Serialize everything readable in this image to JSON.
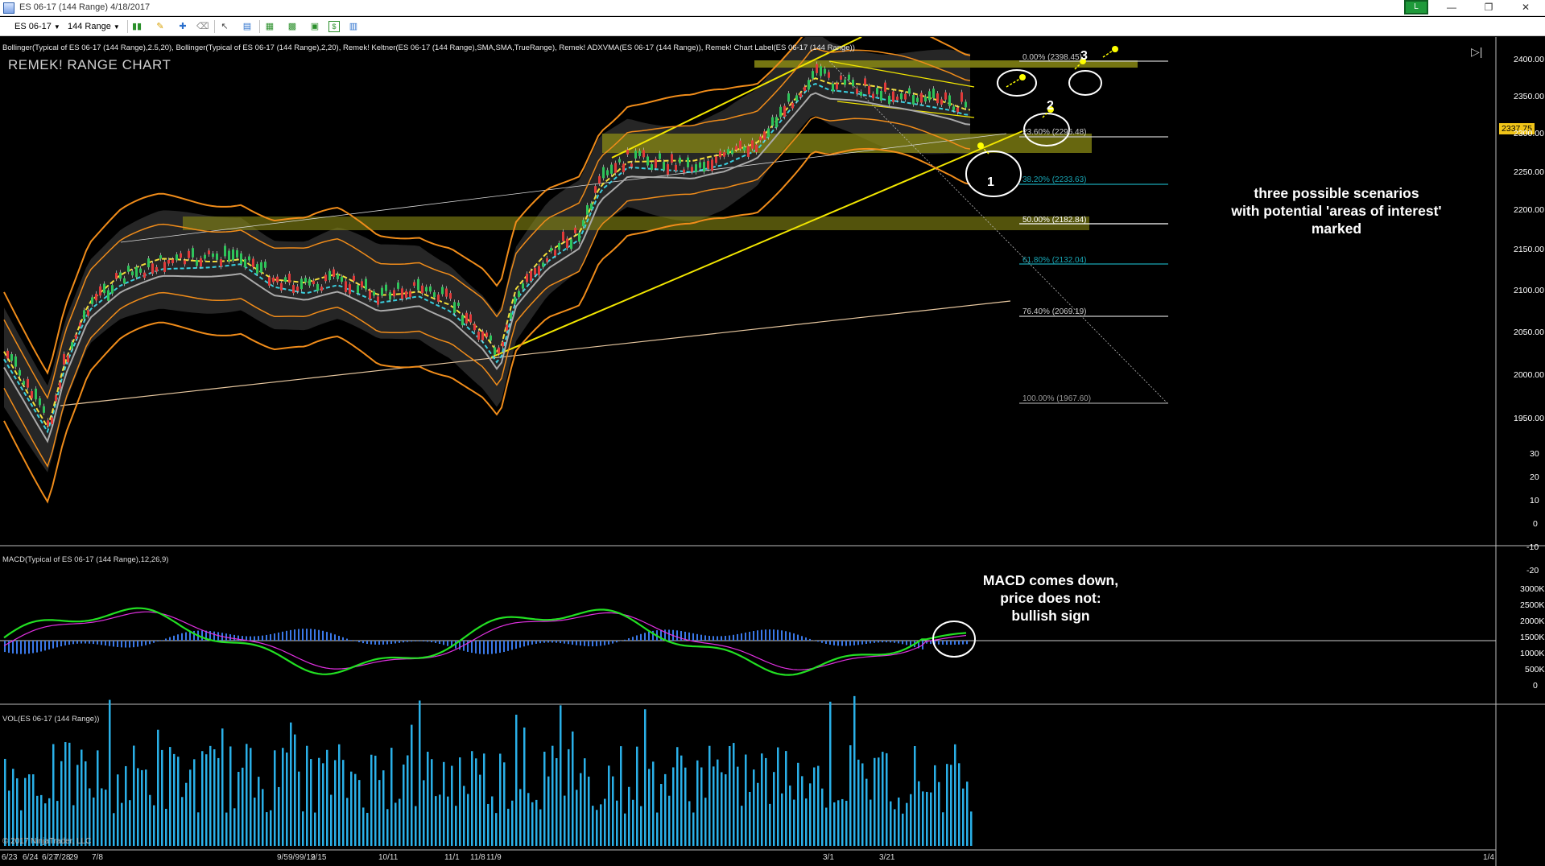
{
  "window": {
    "title": "ES 06-17 (144 Range)  4/18/2017",
    "connection": "L",
    "minimize": "—",
    "restore": "❐",
    "close": "✕"
  },
  "toolbar": {
    "instrument": "ES 06-17",
    "interval": "144 Range",
    "icons": [
      "bar-style-icon",
      "drawing-pencil-icon",
      "crosshair-icon",
      "eraser-icon",
      "pointer-icon",
      "data-box-icon",
      "indicators-icon",
      "strategies-icon",
      "properties-icon",
      "price-marker-icon"
    ]
  },
  "chart": {
    "indicator_description": "Bollinger(Typical of ES 06-17 (144 Range),2.5,20), Bollinger(Typical of ES 06-17 (144 Range),2,20), Remek! Keltner(ES 06-17 (144 Range),SMA,SMA,TrueRange), Remek! ADXVMA(ES 06-17 (144 Range)), Remek! Chart Label(ES 06-17 (144 Range))",
    "label": "REMEK! RANGE CHART",
    "macd_label": "MACD(Typical of ES 06-17 (144 Range),12,26,9)",
    "volume_label": "VOL(ES 06-17 (144 Range))",
    "copyright": "© 2017 NinjaTrader, LLC",
    "last_price": "2337.75",
    "price_ticks": [
      "2400.00",
      "2350.00",
      "2300.00",
      "2250.00",
      "2200.00",
      "2150.00",
      "2100.00",
      "2050.00",
      "2000.00",
      "1950.00"
    ],
    "macd_ticks": [
      "30",
      "20",
      "10",
      "0",
      "-10",
      "-20"
    ],
    "volume_ticks": [
      "3000K",
      "2500K",
      "2000K",
      "1500K",
      "1000K",
      "500K",
      "0"
    ],
    "date_ticks": [
      "6/23",
      "6/24",
      "6/27",
      "7/28",
      "29",
      "7/8",
      "9/5",
      "9/9",
      "9/12",
      "9/15",
      "10/11",
      "11/1",
      "11/8",
      "11/9",
      "3/1",
      "3/21",
      "1/4"
    ],
    "fib_levels": [
      {
        "label": "0.00% (2398.45)",
        "color": "#cccccc"
      },
      {
        "label": "23.60% (2296.48)",
        "color": "#cccccc"
      },
      {
        "label": "38.20% (2233.63)",
        "color": "#19a6b5"
      },
      {
        "label": "50.00% (2182.84)",
        "color": "#ffffff"
      },
      {
        "label": "61.80% (2132.04)",
        "color": "#19a6b5"
      },
      {
        "label": "76.40% (2069.19)",
        "color": "#cccccc"
      },
      {
        "label": "100.00% (1967.60)",
        "color": "#999999"
      }
    ],
    "scenario_numbers": [
      "1",
      "2",
      "3"
    ],
    "annotations": {
      "scenarios": [
        "three possible scenarios",
        "with potential 'areas of interest'",
        "marked"
      ],
      "macd": [
        "MACD comes down,",
        "price does not:",
        "bullish sign"
      ]
    },
    "colors": {
      "bollinger_outer": "#f08c1a",
      "channel_lines": "#f2e600",
      "zones": "#8a8a14",
      "cyan_ma": "#3ad0e0",
      "adxvma": "#f5e03a",
      "macd_line": "#22e022",
      "signal_line": "#e030e0",
      "histogram": "#3a78e8",
      "volume": "#2ab0e8",
      "candle_up": "#2ec45a",
      "candle_down": "#e03a3a"
    }
  }
}
